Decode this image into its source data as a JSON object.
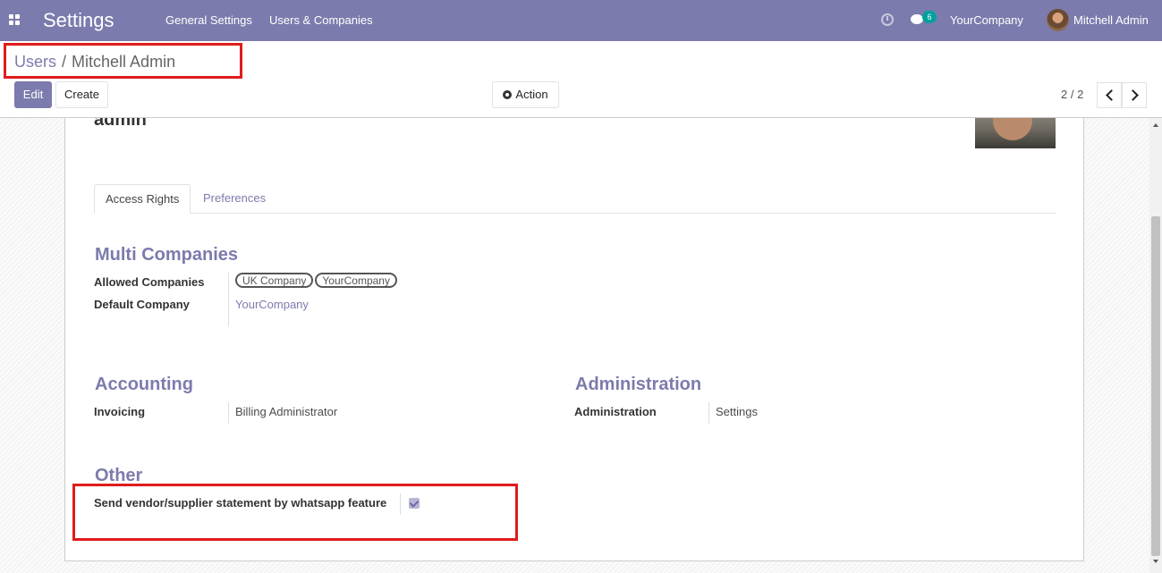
{
  "navbar": {
    "app_title": "Settings",
    "menu": [
      "General Settings",
      "Users & Companies"
    ],
    "chat_count": "6",
    "company": "YourCompany",
    "user": "Mitchell Admin"
  },
  "breadcrumb": {
    "parent": "Users",
    "separator": "/",
    "current": "Mitchell Admin"
  },
  "buttons": {
    "edit": "Edit",
    "create": "Create",
    "action": "Action"
  },
  "pager": {
    "value": "2 / 2"
  },
  "record": {
    "login": "admin"
  },
  "tabs": [
    "Access Rights",
    "Preferences"
  ],
  "multi_companies": {
    "title": "Multi Companies",
    "allowed_label": "Allowed Companies",
    "allowed": [
      "UK Company",
      "YourCompany"
    ],
    "default_label": "Default Company",
    "default_value": "YourCompany"
  },
  "accounting": {
    "title": "Accounting",
    "invoicing_label": "Invoicing",
    "invoicing_value": "Billing Administrator"
  },
  "administration": {
    "title": "Administration",
    "label": "Administration",
    "value": "Settings"
  },
  "other": {
    "title": "Other",
    "whatsapp_label": "Send vendor/supplier statement by whatsapp feature",
    "whatsapp_checked": true
  },
  "colors": {
    "brand": "#7c7bad",
    "highlight": "#e01c1c",
    "badge": "#00a09d"
  }
}
